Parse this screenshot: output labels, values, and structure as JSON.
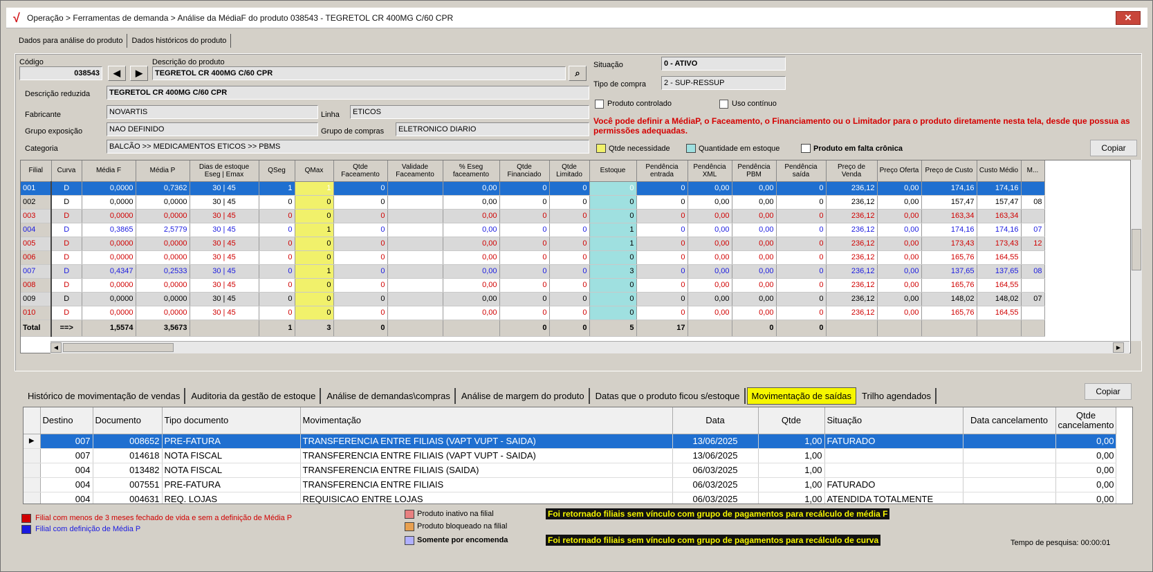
{
  "window": {
    "title": "Operação > Ferramentas de demanda > Análise da MédiaF do produto 038543 - TEGRETOL CR 400MG C/60 CPR",
    "close_label": "✕"
  },
  "top_tabs": [
    "Dados para análise do produto",
    "Dados históricos do produto"
  ],
  "product": {
    "codigo_label": "Código",
    "codigo": "038543",
    "descricao_label": "Descrição do produto",
    "descricao": "TEGRETOL CR 400MG C/60 CPR",
    "descricao_reduzida_label": "Descrição reduzida",
    "descricao_reduzida": "TEGRETOL CR 400MG C/60 CPR",
    "fabricante_label": "Fabricante",
    "fabricante": "NOVARTIS",
    "linha_label": "Linha",
    "linha": "ETICOS",
    "grupo_exposicao_label": "Grupo exposição",
    "grupo_exposicao": "NAO DEFINIDO",
    "grupo_compras_label": "Grupo de compras",
    "grupo_compras": "ELETRONICO DIARIO",
    "categoria_label": "Categoria",
    "categoria": "BALCÃO >> MEDICAMENTOS ETICOS >> PBMS",
    "situacao_label": "Situação",
    "situacao": "0 - ATIVO",
    "tipo_compra_label": "Tipo de compra",
    "tipo_compra": "2 - SUP-RESSUP",
    "produto_controlado_label": "Produto controlado",
    "uso_continuo_label": "Uso contínuo",
    "warning": "Você pode definir a MédiaP, o Faceamento, o Financiamento ou o Limitador para o produto diretamente nesta tela, desde que possua as permissões adequadas.",
    "legend_qtde": "Qtde necessidade",
    "legend_estoque": "Quantidade em estoque",
    "legend_falta": "Produto em falta crônica",
    "copiar": "Copiar"
  },
  "grid": {
    "headers": [
      "Filial",
      "Curva",
      "Média F",
      "Média P",
      "Dias de estoque Eseg | Emax",
      "QSeg",
      "QMax",
      "Qtde Faceamento",
      "Validade Faceamento",
      "% Eseg faceamento",
      "Qtde Financiado",
      "Qtde Limitado",
      "Estoque",
      "Pendência entrada",
      "Pendência XML",
      "Pendência PBM",
      "Pendência saída",
      "Preço de Venda",
      "Preço Oferta",
      "Preço de Custo",
      "Custo Médio",
      "M..."
    ],
    "rows": [
      {
        "f": "001",
        "cu": "D",
        "mf": "0,0000",
        "mp": "0,7362",
        "d": "30  |  45",
        "qs": "1",
        "qm": "1",
        "qf": "0",
        "vf": "",
        "pe": "0,00",
        "qfi": "0",
        "ql": "0",
        "es": "0",
        "pen": "0",
        "px": "0,00",
        "pp": "0,00",
        "ps": "0",
        "pv": "236,12",
        "po": "0,00",
        "pc": "174,16",
        "cm": "174,16",
        "x": ""
      },
      {
        "f": "002",
        "cu": "D",
        "mf": "0,0000",
        "mp": "0,0000",
        "d": "30  |  45",
        "qs": "0",
        "qm": "0",
        "qf": "0",
        "vf": "",
        "pe": "0,00",
        "qfi": "0",
        "ql": "0",
        "es": "0",
        "pen": "0",
        "px": "0,00",
        "pp": "0,00",
        "ps": "0",
        "pv": "236,12",
        "po": "0,00",
        "pc": "157,47",
        "cm": "157,47",
        "x": "08"
      },
      {
        "f": "003",
        "cu": "D",
        "mf": "0,0000",
        "mp": "0,0000",
        "d": "30  |  45",
        "qs": "0",
        "qm": "0",
        "qf": "0",
        "vf": "",
        "pe": "0,00",
        "qfi": "0",
        "ql": "0",
        "es": "0",
        "pen": "0",
        "px": "0,00",
        "pp": "0,00",
        "ps": "0",
        "pv": "236,12",
        "po": "0,00",
        "pc": "163,34",
        "cm": "163,34",
        "x": ""
      },
      {
        "f": "004",
        "cu": "D",
        "mf": "0,3865",
        "mp": "2,5779",
        "d": "30  |  45",
        "qs": "0",
        "qm": "1",
        "qf": "0",
        "vf": "",
        "pe": "0,00",
        "qfi": "0",
        "ql": "0",
        "es": "1",
        "pen": "0",
        "px": "0,00",
        "pp": "0,00",
        "ps": "0",
        "pv": "236,12",
        "po": "0,00",
        "pc": "174,16",
        "cm": "174,16",
        "x": "07"
      },
      {
        "f": "005",
        "cu": "D",
        "mf": "0,0000",
        "mp": "0,0000",
        "d": "30  |  45",
        "qs": "0",
        "qm": "0",
        "qf": "0",
        "vf": "",
        "pe": "0,00",
        "qfi": "0",
        "ql": "0",
        "es": "1",
        "pen": "0",
        "px": "0,00",
        "pp": "0,00",
        "ps": "0",
        "pv": "236,12",
        "po": "0,00",
        "pc": "173,43",
        "cm": "173,43",
        "x": "12"
      },
      {
        "f": "006",
        "cu": "D",
        "mf": "0,0000",
        "mp": "0,0000",
        "d": "30  |  45",
        "qs": "0",
        "qm": "0",
        "qf": "0",
        "vf": "",
        "pe": "0,00",
        "qfi": "0",
        "ql": "0",
        "es": "0",
        "pen": "0",
        "px": "0,00",
        "pp": "0,00",
        "ps": "0",
        "pv": "236,12",
        "po": "0,00",
        "pc": "165,76",
        "cm": "164,55",
        "x": ""
      },
      {
        "f": "007",
        "cu": "D",
        "mf": "0,4347",
        "mp": "0,2533",
        "d": "30  |  45",
        "qs": "0",
        "qm": "1",
        "qf": "0",
        "vf": "",
        "pe": "0,00",
        "qfi": "0",
        "ql": "0",
        "es": "3",
        "pen": "0",
        "px": "0,00",
        "pp": "0,00",
        "ps": "0",
        "pv": "236,12",
        "po": "0,00",
        "pc": "137,65",
        "cm": "137,65",
        "x": "08"
      },
      {
        "f": "008",
        "cu": "D",
        "mf": "0,0000",
        "mp": "0,0000",
        "d": "30  |  45",
        "qs": "0",
        "qm": "0",
        "qf": "0",
        "vf": "",
        "pe": "0,00",
        "qfi": "0",
        "ql": "0",
        "es": "0",
        "pen": "0",
        "px": "0,00",
        "pp": "0,00",
        "ps": "0",
        "pv": "236,12",
        "po": "0,00",
        "pc": "165,76",
        "cm": "164,55",
        "x": ""
      },
      {
        "f": "009",
        "cu": "D",
        "mf": "0,0000",
        "mp": "0,0000",
        "d": "30  |  45",
        "qs": "0",
        "qm": "0",
        "qf": "0",
        "vf": "",
        "pe": "0,00",
        "qfi": "0",
        "ql": "0",
        "es": "0",
        "pen": "0",
        "px": "0,00",
        "pp": "0,00",
        "ps": "0",
        "pv": "236,12",
        "po": "0,00",
        "pc": "148,02",
        "cm": "148,02",
        "x": "07"
      },
      {
        "f": "010",
        "cu": "D",
        "mf": "0,0000",
        "mp": "0,0000",
        "d": "30  |  45",
        "qs": "0",
        "qm": "0",
        "qf": "0",
        "vf": "",
        "pe": "0,00",
        "qfi": "0",
        "ql": "0",
        "es": "0",
        "pen": "0",
        "px": "0,00",
        "pp": "0,00",
        "ps": "0",
        "pv": "236,12",
        "po": "0,00",
        "pc": "165,76",
        "cm": "164,55",
        "x": ""
      }
    ],
    "row_colors": [
      "sel",
      "black",
      "red",
      "blue",
      "red",
      "red",
      "blue",
      "red",
      "black",
      "red"
    ],
    "total": {
      "f": "Total",
      "cu": "==>",
      "mf": "1,5574",
      "mp": "3,5673",
      "qs": "1",
      "qm": "3",
      "qf": "0",
      "qfi": "0",
      "ql": "0",
      "es": "5",
      "pen": "17",
      "pp": "0",
      "ps": "0"
    }
  },
  "bottom_tabs": [
    "Histórico de movimentação de vendas",
    "Auditoria da gestão de estoque",
    "Análise de demandas\\compras",
    "Análise de margem do produto",
    "Datas que o produto ficou s/estoque",
    "Movimentação de saídas",
    "Trilho agendados"
  ],
  "bottom_active_tab": "Movimentação de saídas",
  "bottom_copiar": "Copiar",
  "saidas": {
    "headers": [
      "Destino",
      "Documento",
      "Tipo documento",
      "Movimentação",
      "Data",
      "Qtde",
      "Situação",
      "Data cancelamento",
      "Qtde cancelamento"
    ],
    "rows": [
      {
        "dest": "007",
        "doc": "008652",
        "tipo": "PRE-FATURA",
        "mov": "TRANSFERENCIA ENTRE FILIAIS (VAPT VUPT - SAIDA)",
        "data": "13/06/2025",
        "qtde": "1,00",
        "sit": "FATURADO",
        "dc": "",
        "qc": "0,00"
      },
      {
        "dest": "007",
        "doc": "014618",
        "tipo": "NOTA FISCAL",
        "mov": "TRANSFERENCIA ENTRE FILIAIS (VAPT VUPT - SAIDA)",
        "data": "13/06/2025",
        "qtde": "1,00",
        "sit": "",
        "dc": "",
        "qc": "0,00"
      },
      {
        "dest": "004",
        "doc": "013482",
        "tipo": "NOTA FISCAL",
        "mov": "TRANSFERENCIA ENTRE FILIAIS (SAIDA)",
        "data": "06/03/2025",
        "qtde": "1,00",
        "sit": "",
        "dc": "",
        "qc": "0,00"
      },
      {
        "dest": "004",
        "doc": "007551",
        "tipo": "PRE-FATURA",
        "mov": "TRANSFERENCIA ENTRE FILIAIS",
        "data": "06/03/2025",
        "qtde": "1,00",
        "sit": "FATURADO",
        "dc": "",
        "qc": "0,00"
      },
      {
        "dest": "004",
        "doc": "004631",
        "tipo": "REQ. LOJAS",
        "mov": "REQUISICAO ENTRE LOJAS",
        "data": "06/03/2025",
        "qtde": "1,00",
        "sit": "ATENDIDA TOTALMENTE",
        "dc": "",
        "qc": "0,00"
      }
    ]
  },
  "footer": {
    "legend_red": "Filial com menos de 3 meses fechado de vida e sem a definição de Média P",
    "legend_blue": "Filial com definição de Média P",
    "legend_inativo": "Produto inativo na filial",
    "legend_bloqueado": "Produto bloqueado na filial",
    "legend_encomenda": "Somente por encomenda",
    "hilite1": "Foi retornado filiais sem vínculo com grupo de pagamentos para recálculo de média F",
    "hilite2": "Foi retornado filiais sem vínculo com grupo de pagamentos para recálculo de curva",
    "tempo": "Tempo de pesquisa: 00:00:01"
  },
  "colors": {
    "accent": "#1f6fd0",
    "red": "#d00000",
    "blue": "#1a1ae0",
    "yellow": "#f1f16b",
    "cyan": "#9fe0e0"
  }
}
